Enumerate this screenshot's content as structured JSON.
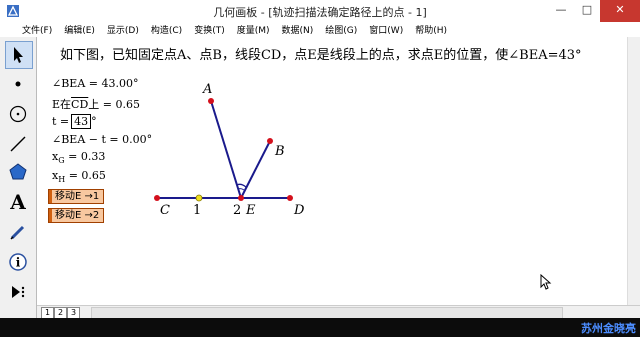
{
  "window": {
    "title": "几何画板 - [轨迹扫描法确定路径上的点 - 1]",
    "controls": [
      "—",
      "□",
      "✕"
    ]
  },
  "menu": [
    "文件(F)",
    "编辑(E)",
    "显示(D)",
    "构造(C)",
    "变换(T)",
    "度量(M)",
    "数据(N)",
    "绘图(G)",
    "窗口(W)",
    "帮助(H)"
  ],
  "toolbar": {
    "tools": [
      "arrow-select-icon",
      "point-icon",
      "compass-icon",
      "straightedge-icon",
      "polygon-icon",
      "text-icon",
      "marker-icon",
      "information-icon",
      "custom-tool-icon"
    ],
    "text_tool_glyph": "A",
    "info_tool_glyph": "i"
  },
  "problem": "如下图，已知固定点A、点B，线段CD，点E是线段上的点，求点E的位置，使∠BEA=43°",
  "measurements": {
    "angle_bea": "∠BEA = 43.00°",
    "e_on_cd_prefix": "E在",
    "e_on_cd_segment": "CD",
    "e_on_cd_suffix": "上 = 0.65",
    "t_label": "t =",
    "t_value": "43",
    "t_unit": "°",
    "diff": "∠BEA − t = 0.00°",
    "xg_label": "x",
    "xg_sub": "G",
    "xg_value": " = 0.33",
    "xh_label": "x",
    "xh_sub": "H",
    "xh_value": " = 0.65"
  },
  "buttons": {
    "move1": "移动E →1",
    "move2": "移动E →2"
  },
  "geometry_labels": {
    "A": "A",
    "B": "B",
    "C": "C",
    "D": "D",
    "E": "E",
    "one": "1",
    "two": "2"
  },
  "pages": [
    "1",
    "2",
    "3"
  ],
  "author": "苏州金晓亮",
  "colors": {
    "point": "#d4101c",
    "segment": "#1a1a8c",
    "midpoint": "#f0e020",
    "button": "#f8c8a0"
  }
}
